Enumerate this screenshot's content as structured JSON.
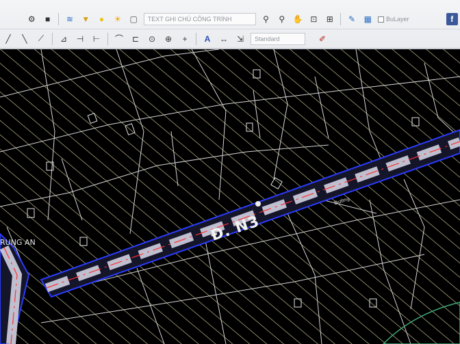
{
  "toolbar": {
    "text_style_combo": "TEXT GHI CHÚ CÔNG TRÌNH",
    "dim_style_combo": "Standard",
    "bylayer_check": "BuLayer",
    "row1_icons": [
      "settings-icon",
      "block-icon",
      "layers-icon",
      "paint-bucket-icon",
      "bulb-icon",
      "sun-icon",
      "lock-icon",
      "text-color-icon",
      "zoom-in-icon",
      "zoom-out-icon",
      "pan-icon",
      "zoom-window-icon",
      "zoom-extents-icon",
      "match-properties-icon",
      "layer-state-icon",
      "facebook-icon"
    ],
    "row2_icons": [
      "line-icon",
      "polyline-icon",
      "measure-icon",
      "offset-icon",
      "trim-icon",
      "extend-icon",
      "fillet-icon",
      "break-icon",
      "move-icon",
      "point-icon",
      "plus-icon",
      "text-icon",
      "dimension-icon",
      "scale-icon",
      "pencil-icon"
    ]
  },
  "map": {
    "road_name": "Đ. N3",
    "street_name": "RUNG AN",
    "parcel_tag": "Đường",
    "colors": {
      "background": "#000000",
      "hatch": "#e3d9a7",
      "parcel_lines": "#d6d6d6",
      "road_band": "#bfbfcf",
      "road_edge": "#2a3cff",
      "road_center": "#ff3030",
      "vegetation": "#3faf7a"
    }
  }
}
